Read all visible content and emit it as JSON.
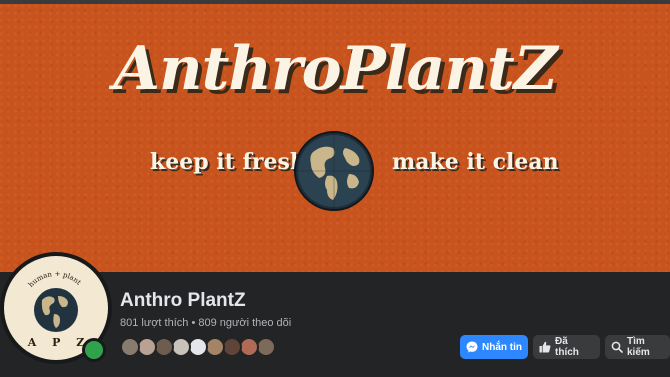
{
  "cover": {
    "title": "AnthroPlantZ",
    "tagline_left": "keep it fresh",
    "tagline_right": "make it clean",
    "background_color": "#c9531d"
  },
  "profile": {
    "avatar_ring_text": "human + plant",
    "avatar_letters": "A P Z",
    "online_status_color": "#31a24c",
    "page_name": "Anthro PlantZ",
    "stats": "801 lượt thích • 809 người theo dõi"
  },
  "follower_avatars": [
    {
      "icon": "friend-avatar",
      "color": "#8a7b6f"
    },
    {
      "icon": "friend-avatar",
      "color": "#b9a293"
    },
    {
      "icon": "friend-avatar",
      "color": "#6e5c4f"
    },
    {
      "icon": "friend-avatar",
      "color": "#c8c2bb"
    },
    {
      "icon": "default-avatar",
      "color": "#e4e6eb"
    },
    {
      "icon": "friend-avatar",
      "color": "#a48466"
    },
    {
      "icon": "friend-avatar",
      "color": "#5f4438"
    },
    {
      "icon": "friend-avatar",
      "color": "#b06a55"
    },
    {
      "icon": "friend-avatar",
      "color": "#7d6a5a"
    }
  ],
  "actions": {
    "message_label": "Nhắn tin",
    "message_icon": "messenger-icon",
    "liked_label": "Đã thích",
    "liked_icon": "thumbs-up-icon",
    "search_label": "Tìm kiếm",
    "search_icon": "search-icon",
    "primary_color": "#2d88ff"
  }
}
